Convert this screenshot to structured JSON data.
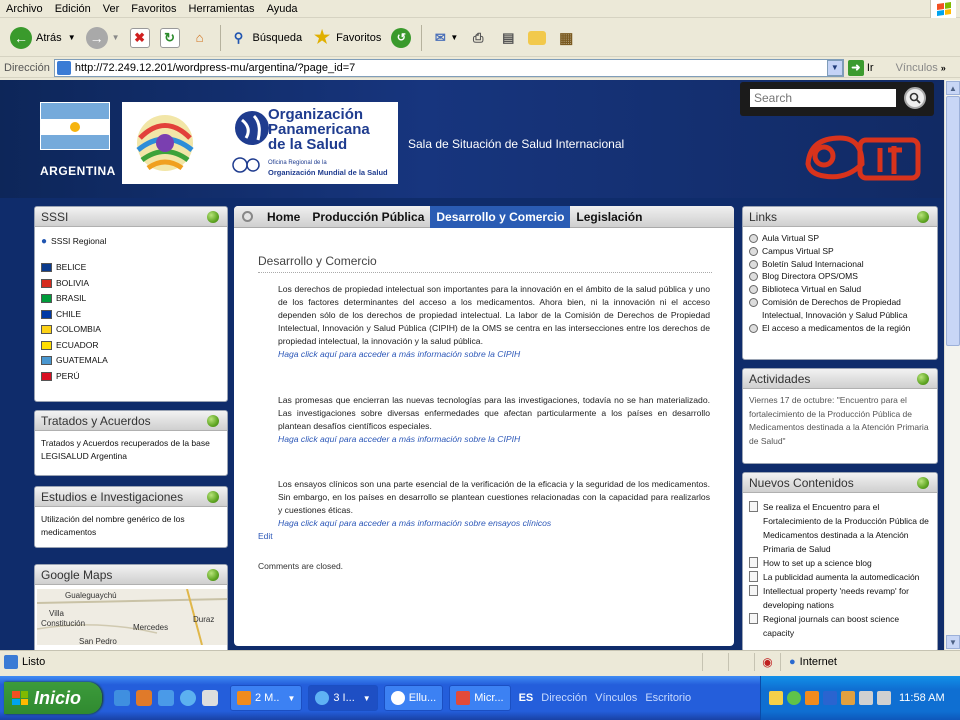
{
  "menu": [
    "Archivo",
    "Edición",
    "Ver",
    "Favoritos",
    "Herramientas",
    "Ayuda"
  ],
  "toolbar": {
    "back": "Atrás",
    "search": "Búsqueda",
    "favorites": "Favoritos"
  },
  "address": {
    "label": "Dirección",
    "url": "http://72.249.12.201/wordpress-mu/argentina/?page_id=7",
    "go": "Ir",
    "links": "Vínculos"
  },
  "header": {
    "country": "ARGENTINA",
    "org_name": [
      "Organización",
      "Panamericana",
      "de la Salud"
    ],
    "org_sub1": "Oficina Regional de la",
    "org_sub2": "Organización Mundial de la Salud",
    "site_title": "Sala de Situación de Salud Internacional",
    "search_placeholder": "Search"
  },
  "sssi": {
    "title": "SSSI",
    "regional": "SSSI Regional",
    "countries": [
      {
        "name": "BELICE",
        "color": "#0b3a8c"
      },
      {
        "name": "BOLIVIA",
        "color": "#d52b1e"
      },
      {
        "name": "BRASIL",
        "color": "#009c3b"
      },
      {
        "name": "CHILE",
        "color": "#0039a6"
      },
      {
        "name": "COLOMBIA",
        "color": "#fcd116"
      },
      {
        "name": "ECUADOR",
        "color": "#ffdd00"
      },
      {
        "name": "GUATEMALA",
        "color": "#4997d0"
      },
      {
        "name": "PERÚ",
        "color": "#d91023"
      }
    ]
  },
  "tratados": {
    "title": "Tratados y Acuerdos",
    "text": "Tratados y Acuerdos recuperados de la base LEGISALUD Argentina"
  },
  "estudios": {
    "title": "Estudios e Investigaciones",
    "text": "Utilización del nombre genérico de los medicamentos"
  },
  "maps": {
    "title": "Google Maps",
    "labels": [
      "Gualeguaychú",
      "Villa",
      "Constitución",
      "Mercedes",
      "Duraz",
      "San Pedro"
    ]
  },
  "nav": {
    "tabs": [
      "Home",
      "Producción Pública",
      "Desarrollo y Comercio",
      "Legislación"
    ],
    "active": 2
  },
  "article": {
    "title": "Desarrollo y Comercio",
    "paras": [
      {
        "text": "Los derechos de propiedad intelectual son importantes para la innovación en el ámbito de la salud pública y uno de los factores determinantes del acceso a los medicamentos. Ahora bien, ni la innovación ni el acceso dependen sólo de los derechos de propiedad intelectual. La labor de la Comisión de Derechos de Propiedad Intelectual, Innovación y Salud Pública (CIPIH) de la OMS se centra en las intersecciones entre los derechos de propiedad intelectual, la innovación y la salud pública.",
        "link": "Haga click aquí para acceder a más información sobre la CIPIH"
      },
      {
        "text": "Las promesas que encierran las nuevas tecnologías para las investigaciones, todavía no se han materializado. Las investigaciones sobre diversas enfermedades que afectan particularmente a los países en desarrollo plantean desafíos científicos especiales.",
        "link": "Haga click aquí para acceder a más información sobre la CIPIH"
      },
      {
        "text": "Los ensayos clínicos son una parte esencial de la verificación de la eficacia y la seguridad de los medicamentos. Sin embargo, en los países en desarrollo se plantean cuestiones relacionadas con la capacidad para realizarlos y cuestiones éticas.",
        "link": "Haga click aquí para acceder a más información sobre ensayos clínicos"
      }
    ],
    "edit": "Edit",
    "closed": "Comments are closed."
  },
  "links": {
    "title": "Links",
    "items": [
      "Aula Virtual SP",
      "Campus Virtual SP",
      "Boletín Salud Internacional",
      "Blog Directora OPS/OMS",
      "Biblioteca Virtual en Salud",
      "Comisión de Derechos de Propiedad Intelectual, Innovación y Salud Pública",
      "El acceso a medicamentos de la región"
    ]
  },
  "actividades": {
    "title": "Actividades",
    "text": "Viernes 17 de octubre: \"Encuentro para el fortalecimiento de la Producción Pública de Medicamentos destinada a la Atención Primaria de Salud\""
  },
  "nuevos": {
    "title": "Nuevos Contenidos",
    "items": [
      "Se realiza el Encuentro para el Fortalecimiento de la Producción Pública de Medicamentos destinada a la Atención Primaria de Salud",
      "How to set up a science blog",
      "La publicidad aumenta la automedicación",
      "Intellectual property 'needs revamp' for developing nations",
      "Regional journals can boost science capacity"
    ]
  },
  "status": {
    "text": "Listo",
    "zone": "Internet"
  },
  "taskbar": {
    "start": "Inicio",
    "tasks": [
      "2 M..",
      "3 I...",
      "Ellu...",
      "Micr..."
    ],
    "lang": "ES",
    "toolbars": [
      "Dirección",
      "Vínculos",
      "Escritorio"
    ],
    "clock": "11:58 AM"
  },
  "colors": {
    "page_bg": "#0f2c6b",
    "tab_active": "#2a5cb4",
    "link": "#2d58b8",
    "start": "#3c9b3b",
    "taskbar": "#245edb"
  }
}
